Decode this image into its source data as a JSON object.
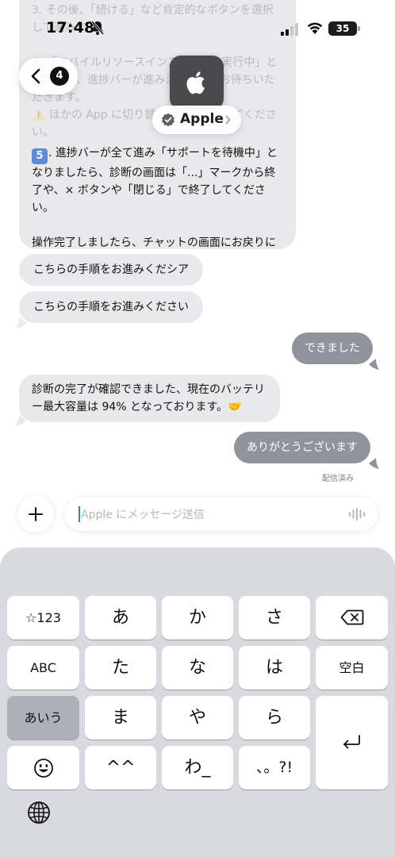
{
  "status_bar": {
    "time": "17:48",
    "battery_level": "35",
    "icons": [
      "bell-slash-icon",
      "cellular-signal-icon",
      "wifi-icon",
      "battery-icon"
    ]
  },
  "header": {
    "back_badge_count": "4",
    "contact_name": "Apple",
    "icons": [
      "back-chevron-icon",
      "apple-logo-icon",
      "verified-icon",
      "chevron-right-icon"
    ]
  },
  "messages": {
    "instructions": {
      "faded_text": "3. その後、「続ける」など肯定的なボタンを選択して進みます。\n\n4. 「モバイルリソースインスペクタを実行中」と表示され、進捗バーが進みます。数分お待ちいただきます。\n⚠️ ほかの App に切り替えないようにしてください。",
      "step5_number": "5",
      "step5_text": ". 進捗バーが全て進み「サポートを待機中」となりましたら、診断の画面は「...」マークから終了や、× ボタンや「閉じる」で終了してください。",
      "closing_text": "操作完了しましたら、チャットの画面にお戻りになり、お知らせくださいませ。"
    },
    "incoming_1": "こちらの手順をお進みくだシア",
    "incoming_2": "こちらの手順をお進みください",
    "outgoing_1": "できました",
    "incoming_3": "診断の完了が確認できました、現在のバッテリー最大容量は 94% となっております。🤝",
    "outgoing_2": "ありがとうございます",
    "delivered_status": "配信済み"
  },
  "composer": {
    "placeholder": "Apple にメッセージ送信",
    "icons": [
      "plus-icon",
      "waveform-icon"
    ]
  },
  "keyboard": {
    "row1": [
      "☆123",
      "あ",
      "か",
      "さ"
    ],
    "row2": [
      "ABC",
      "た",
      "な",
      "は",
      "空白"
    ],
    "row3": [
      "あいう",
      "ま",
      "や",
      "ら"
    ],
    "row4": [
      "^^",
      "わ_",
      "、。?!"
    ],
    "icons": [
      "delete-icon",
      "return-icon",
      "emoji-icon",
      "globe-icon"
    ]
  },
  "colors": {
    "incoming_bubble": "#e9e9eb",
    "outgoing_bubble": "#8e939c",
    "keyboard_background": "#d9dadf",
    "dark_key": "#acb0b8"
  }
}
